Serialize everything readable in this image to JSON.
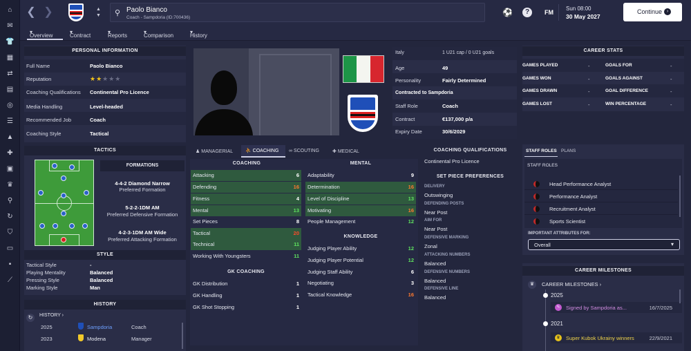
{
  "header": {
    "name": "Paolo Bianco",
    "subtitle": "Coach - Sampdoria (ID:700436)",
    "fm_label": "FM",
    "date_day": "Sun 08:00",
    "date_full": "30 May 2027",
    "continue_label": "Continue"
  },
  "tabs": {
    "overview": "Overview",
    "contract": "Contract",
    "reports": "Reports",
    "comparison": "Comparison",
    "history": "History"
  },
  "personal": {
    "title": "PERSONAL INFORMATION",
    "rows": [
      {
        "label": "Full Name",
        "value": "Paolo Bianco"
      },
      {
        "label": "Reputation",
        "value": ""
      },
      {
        "label": "Coaching Qualifications",
        "value": "Continental Pro Licence"
      },
      {
        "label": "Media Handling",
        "value": "Level-headed"
      },
      {
        "label": "Recommended Job",
        "value": "Coach"
      },
      {
        "label": "Coaching Style",
        "value": "Tactical"
      }
    ],
    "reputation_stars": 2,
    "reputation_max": 5
  },
  "tactics": {
    "title": "TACTICS",
    "formations_title": "FORMATIONS",
    "formations": [
      {
        "name": "4-4-2 Diamond Narrow",
        "desc": "Preferred Formation"
      },
      {
        "name": "5-2-2-1DM AM",
        "desc": "Preferred Defensive Formation"
      },
      {
        "name": "4-2-3-1DM AM Wide",
        "desc": "Preferred Attacking Formation"
      }
    ]
  },
  "style": {
    "title": "STYLE",
    "rows": [
      {
        "label": "Tactical Style",
        "value": "-"
      },
      {
        "label": "Playing Mentality",
        "value": "Balanced"
      },
      {
        "label": "Pressing Style",
        "value": "Balanced"
      },
      {
        "label": "Marking Style",
        "value": "Man"
      }
    ]
  },
  "history": {
    "title": "HISTORY",
    "link": "HISTORY",
    "rows": [
      {
        "year": "2025",
        "club": "Sampdoria",
        "role": "Coach"
      },
      {
        "year": "2023",
        "club": "Modena",
        "role": "Manager"
      }
    ]
  },
  "info": {
    "rows": [
      {
        "label": "Italy",
        "value": "1 U21 cap / 0 U21 goals"
      },
      {
        "label": "Age",
        "value": "49"
      },
      {
        "label": "Personality",
        "value": "Fairly Determined"
      },
      {
        "label": "Contracted to Sampdoria",
        "value": ""
      },
      {
        "label": "Staff Role",
        "value": "Coach"
      },
      {
        "label": "Contract",
        "value": "€137,000 p/a"
      },
      {
        "label": "Expiry Date",
        "value": "30/6/2029"
      }
    ]
  },
  "attr_tabs": {
    "managerial": "MANAGERIAL",
    "coaching": "COACHING",
    "scouting": "SCOUTING",
    "medical": "MEDICAL"
  },
  "coaching": {
    "title": "COACHING",
    "rows": [
      {
        "name": "Attacking",
        "value": "6"
      },
      {
        "name": "Defending",
        "value": "16"
      },
      {
        "name": "Fitness",
        "value": "4"
      },
      {
        "name": "Mental",
        "value": "13"
      },
      {
        "name": "Set Pieces",
        "value": "8"
      },
      {
        "name": "Tactical",
        "value": "20"
      },
      {
        "name": "Technical",
        "value": "11"
      },
      {
        "name": "Working With Youngsters",
        "value": "11"
      }
    ]
  },
  "gk_coaching": {
    "title": "GK COACHING",
    "rows": [
      {
        "name": "GK Distribution",
        "value": "1"
      },
      {
        "name": "GK Handling",
        "value": "1"
      },
      {
        "name": "GK Shot Stopping",
        "value": "1"
      }
    ]
  },
  "mental": {
    "title": "MENTAL",
    "rows": [
      {
        "name": "Adaptability",
        "value": "9"
      },
      {
        "name": "Determination",
        "value": "16"
      },
      {
        "name": "Level of Discipline",
        "value": "13"
      },
      {
        "name": "Motivating",
        "value": "16"
      },
      {
        "name": "People Management",
        "value": "12"
      }
    ]
  },
  "knowledge": {
    "title": "KNOWLEDGE",
    "rows": [
      {
        "name": "Judging Player Ability",
        "value": "12"
      },
      {
        "name": "Judging Player Potential",
        "value": "12"
      },
      {
        "name": "Judging Staff Ability",
        "value": "6"
      },
      {
        "name": "Negotiating",
        "value": "3"
      },
      {
        "name": "Tactical Knowledge",
        "value": "16"
      }
    ]
  },
  "qualifications": {
    "title": "COACHING QUALIFICATIONS",
    "value": "Continental Pro Licence"
  },
  "set_piece": {
    "title": "SET PIECE PREFERENCES",
    "rows": [
      {
        "label": "DELIVERY",
        "value": "Outswinging"
      },
      {
        "label": "DEFENDING POSTS",
        "value": "Near Post"
      },
      {
        "label": "AIM FOR",
        "value": "Near Post"
      },
      {
        "label": "DEFENSIVE MARKING",
        "value": "Zonal"
      },
      {
        "label": "ATTACKING NUMBERS",
        "value": "Balanced"
      },
      {
        "label": "DEFENSIVE NUMBERS",
        "value": "Balanced"
      },
      {
        "label": "DEFENSIVE LINE",
        "value": "Balanced"
      }
    ]
  },
  "career_stats": {
    "title": "CAREER STATS",
    "left": [
      {
        "label": "GAMES PLAYED",
        "value": "-"
      },
      {
        "label": "GAMES WON",
        "value": "-"
      },
      {
        "label": "GAMES DRAWN",
        "value": "-"
      },
      {
        "label": "GAMES LOST",
        "value": "-"
      }
    ],
    "right": [
      {
        "label": "GOALS FOR",
        "value": "-"
      },
      {
        "label": "GOALS AGAINST",
        "value": "-"
      },
      {
        "label": "GOAL DIFFERENCE",
        "value": "-"
      },
      {
        "label": "WIN PERCENTAGE",
        "value": "-"
      }
    ]
  },
  "staff_roles": {
    "tab1": "STAFF ROLES",
    "tab2": "PLANS",
    "header": "STAFF ROLES",
    "roles": [
      "Head Performance Analyst",
      "Performance Analyst",
      "Recruitment Analyst",
      "Sports Scientist"
    ],
    "important_label": "IMPORTANT ATTRIBUTES FOR:",
    "select_value": "Overall"
  },
  "milestones": {
    "title": "CAREER MILESTONES",
    "link": "CAREER MILESTONES",
    "items": [
      {
        "year": "2025",
        "text": "Signed by Sampdoria as...",
        "date": "16/7/2025"
      },
      {
        "year": "2021",
        "text": "Super Kubok Ukrainy winners",
        "date": "22/9/2021"
      }
    ]
  }
}
